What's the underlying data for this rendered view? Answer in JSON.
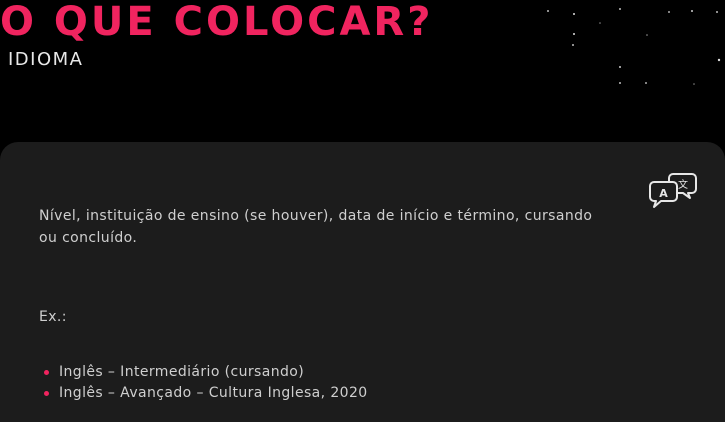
{
  "header": {
    "title": "O QUE COLOCAR?",
    "subtitle": "IDIOMA"
  },
  "card": {
    "icon": "translate-icon",
    "description": "Nível, instituição de ensino (se houver), data de início e término, cursando ou concluído.",
    "example_label": "Ex.:",
    "examples": [
      "Inglês – Intermediário (cursando)",
      "Inglês – Avançado – Cultura Inglesa, 2020"
    ]
  },
  "colors": {
    "accent": "#f0245f",
    "background": "#000000",
    "card": "#1c1c1c",
    "text": "#cfcfcf"
  }
}
